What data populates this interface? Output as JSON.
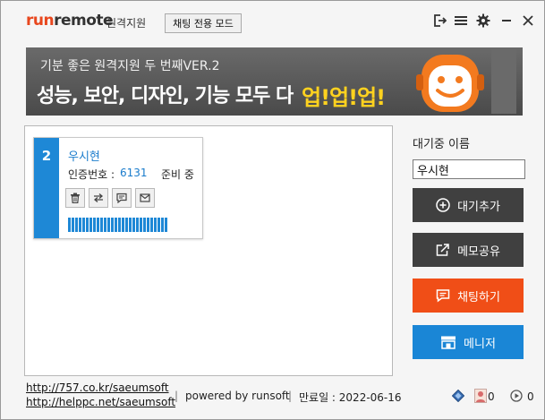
{
  "app": {
    "logo_run": "run",
    "logo_remote": "remote",
    "logo_sub": "원격지원",
    "chat_mode_label": "채팅 전용 모드"
  },
  "banner": {
    "line1": "기분 좋은 원격지원 두 번째VER.2",
    "line2": "성능, 보안, 디자인, 기능 모두 다",
    "highlight": "업!업!업!"
  },
  "sessions": [
    {
      "number": "2",
      "name": "우시현",
      "auth_label": "인증번호 :",
      "auth_code": "6131",
      "status": "준비 중"
    }
  ],
  "sidebar": {
    "waiting_name_label": "대기중 이름",
    "waiting_name_value": "우시현",
    "add_waiting_label": "대기추가",
    "share_memo_label": "메모공유",
    "chat_label": "채팅하기",
    "manager_label": "메니저"
  },
  "footer": {
    "link1": "http://757.co.kr/saeumsoft",
    "link2": "http://helppc.net/saeumsoft",
    "powered": "powered by runsoft",
    "expiry": "만료일 : 2022-06-16",
    "count_left": "0",
    "count_right": "0"
  },
  "colors": {
    "brand_orange": "#e8471e",
    "session_blue": "#1e88d6",
    "chat_orange": "#f04e17",
    "manager_blue": "#1a86d6",
    "dark_button": "#404040",
    "highlight_yellow": "#ffd21f"
  },
  "icons": {
    "titlebar": [
      "exit-icon",
      "menu-icon",
      "gear-icon",
      "minimize-icon",
      "close-icon"
    ],
    "card_actions": [
      "trash-icon",
      "transfer-icon",
      "chat-icon",
      "mail-icon"
    ]
  }
}
